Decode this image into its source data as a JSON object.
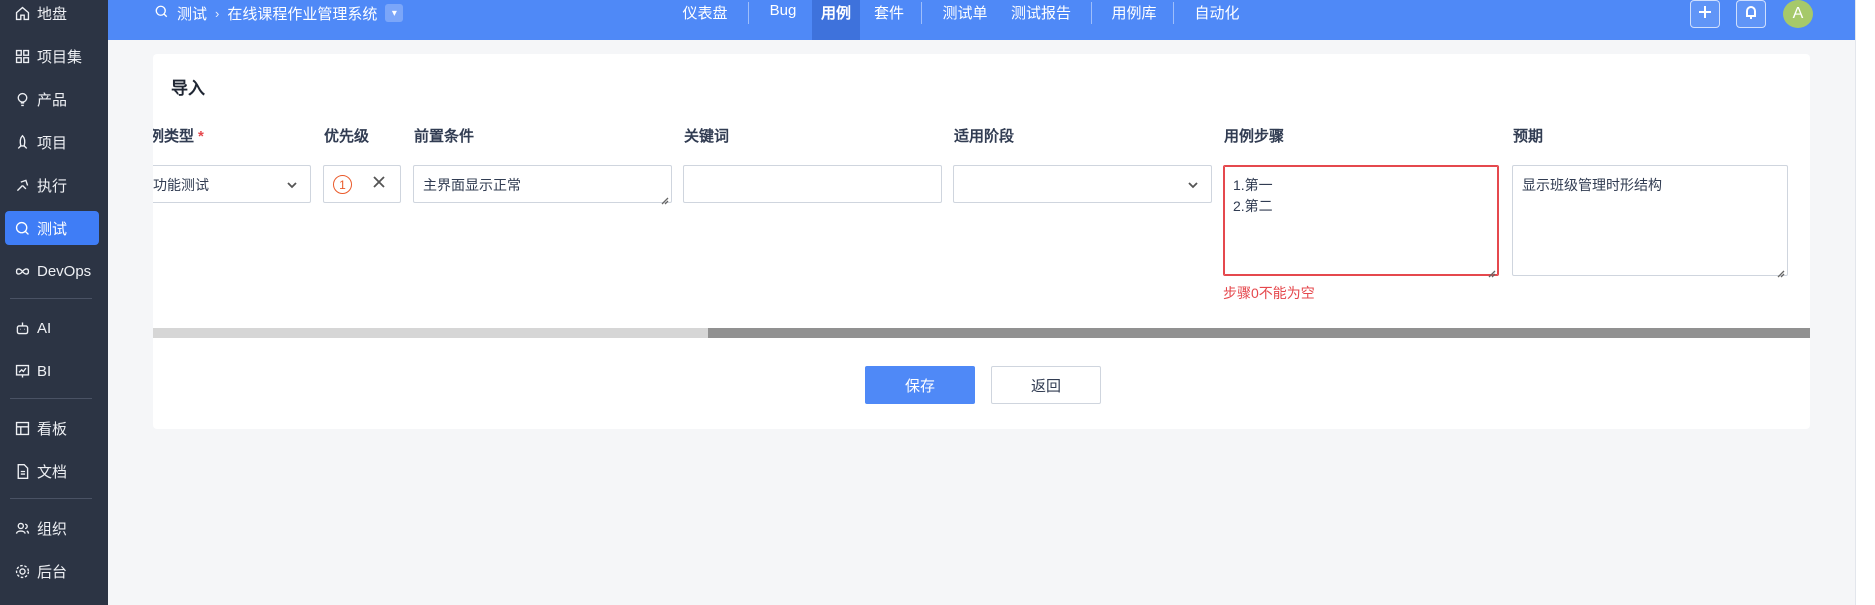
{
  "sidebar": {
    "items": [
      {
        "label": "地盘",
        "icon": "home-icon"
      },
      {
        "label": "项目集",
        "icon": "grid-icon"
      },
      {
        "label": "产品",
        "icon": "lightbulb-icon"
      },
      {
        "label": "项目",
        "icon": "rocket-icon"
      },
      {
        "label": "执行",
        "icon": "run-icon"
      },
      {
        "label": "测试",
        "icon": "test-search-icon"
      },
      {
        "label": "DevOps",
        "icon": "infinity-icon"
      },
      {
        "label": "AI",
        "icon": "robot-icon"
      },
      {
        "label": "BI",
        "icon": "chart-board-icon"
      },
      {
        "label": "看板",
        "icon": "kanban-icon"
      },
      {
        "label": "文档",
        "icon": "document-icon"
      },
      {
        "label": "组织",
        "icon": "people-icon"
      },
      {
        "label": "后台",
        "icon": "gear-icon"
      }
    ],
    "active": "测试"
  },
  "topbar": {
    "breadcrumb": {
      "module": "测试",
      "project": "在线课程作业管理系统"
    },
    "nav": [
      "仪表盘",
      "Bug",
      "用例",
      "套件",
      "测试单",
      "测试报告",
      "用例库",
      "自动化"
    ],
    "active_nav": "用例",
    "avatar_letter": "A"
  },
  "form": {
    "title": "导入",
    "columns": {
      "type": "用例类型",
      "priority": "优先级",
      "precondition": "前置条件",
      "keywords": "关键词",
      "stage": "适用阶段",
      "steps": "用例步骤",
      "expect": "预期"
    },
    "required_mark": "*",
    "row": {
      "type": "功能测试",
      "priority": "1",
      "precondition": "主界面显示正常",
      "keywords": "",
      "stage": "",
      "steps": [
        "1.第一",
        "2.第二"
      ],
      "expect": "显示班级管理时形结构"
    },
    "error_message": "步骤0不能为空",
    "scroll": {
      "thumb_start": 0.335,
      "thumb_fraction": 0.665
    }
  },
  "buttons": {
    "save": "保存",
    "back": "返回"
  },
  "colors": {
    "primary": "#4f89f7",
    "sidebar": "#2c3444",
    "error": "#e5484d",
    "priority": "#ea5a2a"
  }
}
